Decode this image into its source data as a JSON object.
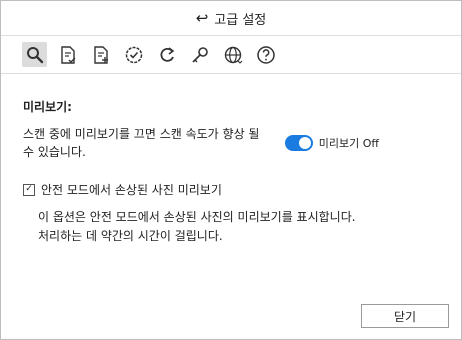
{
  "window": {
    "title": "고급 설정",
    "back_icon": "↩"
  },
  "toolbar": {
    "items": [
      {
        "name": "search"
      },
      {
        "name": "document-check"
      },
      {
        "name": "document-add"
      },
      {
        "name": "check-circle"
      },
      {
        "name": "refresh"
      },
      {
        "name": "key"
      },
      {
        "name": "globe"
      },
      {
        "name": "help"
      }
    ]
  },
  "preview": {
    "heading": "미리보기:",
    "description": "스캔 중에 미리보기를 끄면 스캔 속도가 향상 될 수 있습니다.",
    "toggle_label": "미리보기 Off"
  },
  "safe_mode": {
    "checkbox_label": "안전 모드에서 손상된 사진 미리보기",
    "checked": true,
    "info_line1": "이 옵션은 안전 모드에서 손상된 사진의 미리보기를 표시합니다.",
    "info_line2": "처리하는 데 약간의 시간이 걸립니다."
  },
  "footer": {
    "close_label": "닫기"
  },
  "colors": {
    "accent": "#1a7be0"
  }
}
